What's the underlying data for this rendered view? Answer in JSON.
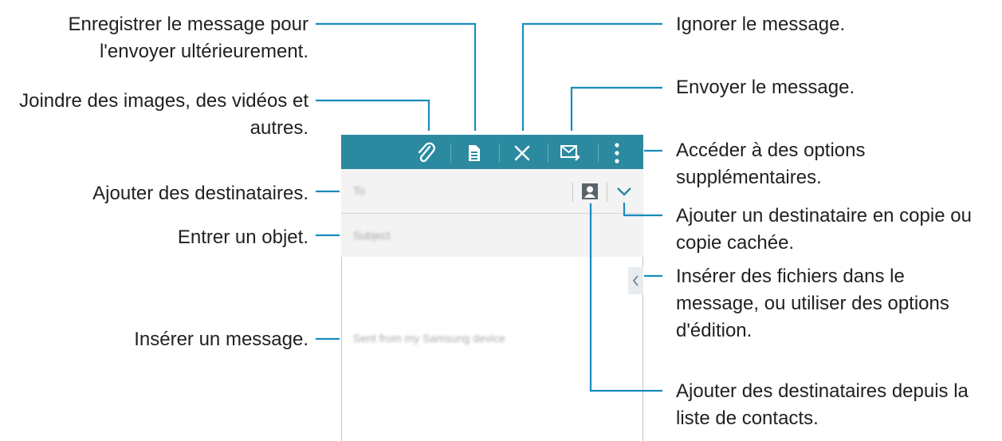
{
  "labels": {
    "save": [
      "Enregistrer le message pour",
      "l'envoyer ultérieurement."
    ],
    "attach": [
      "Joindre des images, des vidéos et",
      "autres."
    ],
    "add_recipients": "Ajouter des destinataires.",
    "subject": "Entrer un objet.",
    "insert_message": "Insérer un message.",
    "discard": "Ignorer le message.",
    "send": "Envoyer le message.",
    "more_options": [
      "Accéder à des options",
      "supplémentaires."
    ],
    "cc_bcc": [
      "Ajouter un destinataire en copie ou",
      "copie cachée."
    ],
    "insert_files": [
      "Insérer des fichiers dans le",
      "message, ou utiliser des options",
      "d'édition."
    ],
    "contacts": [
      "Ajouter des destinataires depuis la",
      "liste de contacts."
    ]
  },
  "compose": {
    "to_placeholder": "To",
    "subject_placeholder": "Subject",
    "signature": "Sent from my Samsung device"
  },
  "icons": [
    "attach-icon",
    "save-icon",
    "close-icon",
    "send-icon",
    "more-icon",
    "contact-icon",
    "chevron-down-icon",
    "chevron-left-icon"
  ],
  "colors": {
    "toolbar": "#2b8a9f",
    "callout_line": "#1a8bbd",
    "field_bg": "#f3f3f3"
  }
}
